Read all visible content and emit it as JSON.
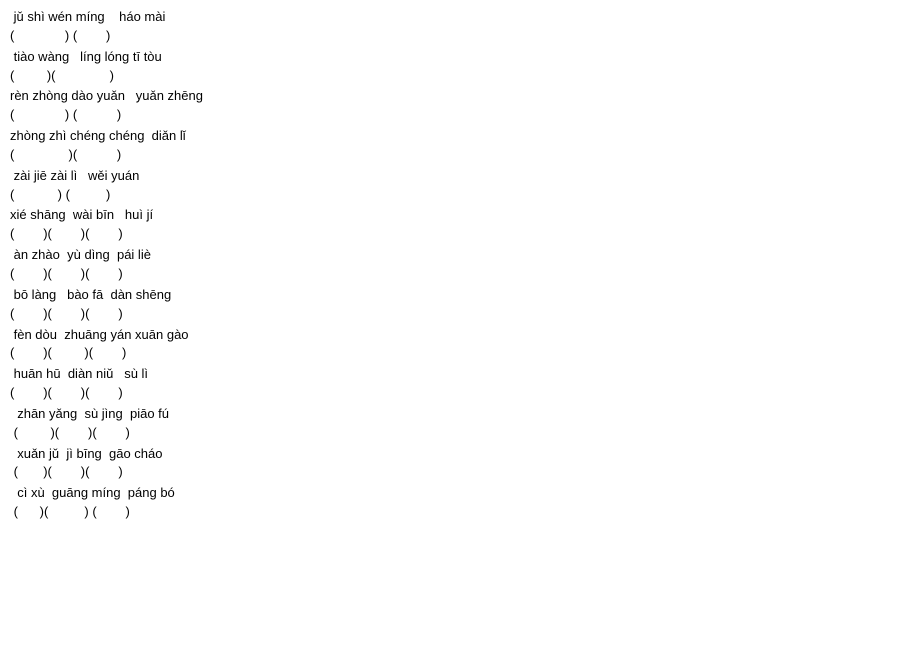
{
  "lines": {
    "l1_pinyin": " jǔ shì wén míng    háo mài",
    "l1_paren": "(              ) (        )",
    "l2_pinyin": " tiào wàng   líng lóng tī tòu",
    "l2_paren": "(         )(               )",
    "l3_pinyin": "rèn zhòng dào yuǎn   yuǎn zhēng",
    "l3_paren": "(              ) (           )",
    "l4_pinyin": "zhòng zhì chéng chéng  diǎn lǐ",
    "l4_paren": "(               )(           )",
    "l5_pinyin": " zài jiē zài lì   wěi yuán",
    "l5_paren": "(            ) (          )",
    "l6_pinyin": "xié shāng  wài bīn   huì jí",
    "l6_paren": "(        )(        )(        )",
    "l7_pinyin": " àn zhào  yù dìng  pái liè",
    "l7_paren": "(        )(        )(        )",
    "l8_pinyin": " bō làng   bào fā  dàn shēng",
    "l8_paren": "(        )(        )(        )",
    "l9_pinyin": " fèn dòu  zhuāng yán xuān gào",
    "l9_paren": "(        )(         )(        )",
    "l10_pinyin": " huān hū  diàn niǔ   sù lì",
    "l10_paren": "(        )(        )(        )",
    "l11_pinyin": "  zhān yǎng  sù jìng  piāo fú",
    "l11_paren": " (         )(        )(        )",
    "l12_pinyin": "  xuǎn jǔ  jì bīng  gāo cháo",
    "l12_paren": " (       )(        )(        )",
    "l13_pinyin": "  cì xù  guāng míng  páng bó",
    "l13_paren": " (      )(          ) (        )"
  }
}
